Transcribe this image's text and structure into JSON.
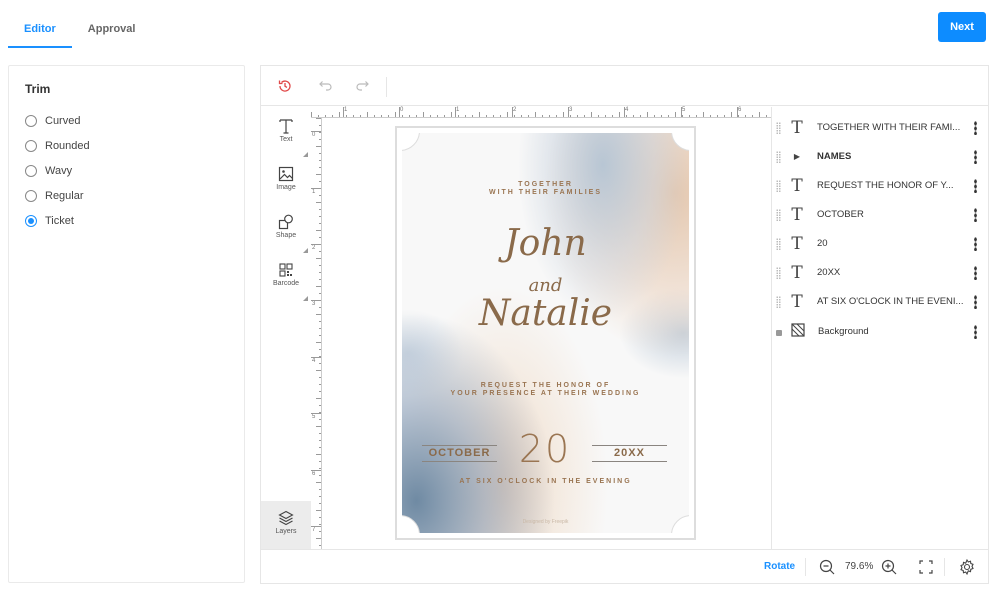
{
  "header": {
    "tabs": [
      {
        "label": "Editor",
        "active": true
      },
      {
        "label": "Approval",
        "active": false
      }
    ],
    "next_label": "Next"
  },
  "trim": {
    "title": "Trim",
    "options": [
      {
        "label": "Curved",
        "checked": false
      },
      {
        "label": "Rounded",
        "checked": false
      },
      {
        "label": "Wavy",
        "checked": false
      },
      {
        "label": "Regular",
        "checked": false
      },
      {
        "label": "Ticket",
        "checked": true
      }
    ]
  },
  "toolbar": {
    "icons": [
      "history-icon",
      "undo-icon",
      "redo-icon"
    ],
    "history_color": "#e04848"
  },
  "tools": [
    {
      "label": "Text",
      "icon": "text-icon"
    },
    {
      "label": "Image",
      "icon": "image-icon"
    },
    {
      "label": "Shape",
      "icon": "shape-icon"
    },
    {
      "label": "Barcode",
      "icon": "barcode-icon"
    },
    {
      "label": "Layers",
      "icon": "layers-icon"
    }
  ],
  "rulers": {
    "top": [
      "1",
      "0",
      "1",
      "2",
      "3",
      "4",
      "5",
      "6"
    ],
    "left": [
      "0",
      "1",
      "2",
      "3",
      "4",
      "5",
      "6",
      "7"
    ]
  },
  "card": {
    "line1": "TOGETHER",
    "line2": "WITH THEIR FAMILIES",
    "name1": "John",
    "and": "and",
    "name2": "Natalie",
    "request1": "REQUEST THE HONOR OF",
    "request2": "YOUR PRESENCE AT THEIR WEDDING",
    "month": "OCTOBER",
    "day": "20",
    "year": "20XX",
    "time": "AT SIX O'CLOCK IN THE EVENING",
    "credit": "Designed by Freepik"
  },
  "layers": [
    {
      "name": "TOGETHER WITH THEIR FAMI...",
      "type": "text",
      "bold": false
    },
    {
      "name": "NAMES",
      "type": "group",
      "bold": true
    },
    {
      "name": "REQUEST THE HONOR OF Y...",
      "type": "text",
      "bold": false
    },
    {
      "name": "OCTOBER",
      "type": "text",
      "bold": false
    },
    {
      "name": "20",
      "type": "text",
      "bold": false
    },
    {
      "name": "20XX",
      "type": "text",
      "bold": false
    },
    {
      "name": "AT SIX O'CLOCK IN THE EVENI...",
      "type": "text",
      "bold": false
    },
    {
      "name": "Background",
      "type": "background",
      "bold": false,
      "locked": true
    }
  ],
  "footer": {
    "rotate_label": "Rotate",
    "zoom_value": "79.6%"
  },
  "colors": {
    "accent": "#1a90ff",
    "card_text": "#9a7552"
  }
}
